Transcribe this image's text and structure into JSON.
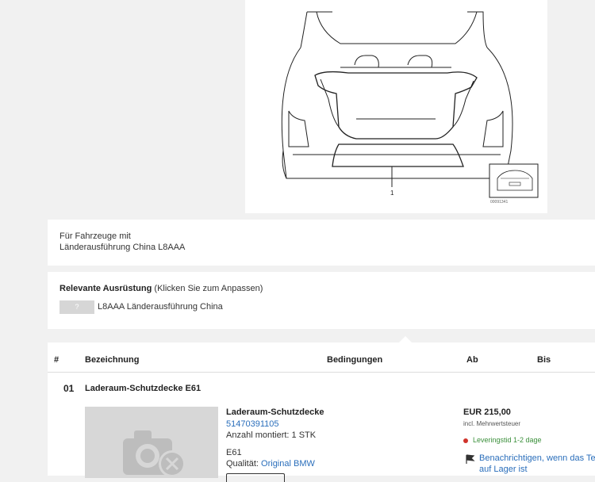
{
  "diagram": {
    "callout": "1",
    "thumb_code": "00091341"
  },
  "vehicle_note": {
    "line1": "Für Fahrzeuge mit",
    "line2": "Länderausführung China L8AAA"
  },
  "equipment": {
    "heading": "Relevante Ausrüstung",
    "hint": "(Klicken Sie zum Anpassen)",
    "chip": "?",
    "item": "L8AAA Länderausführung China"
  },
  "table": {
    "headers": {
      "num": "#",
      "name": "Bezeichnung",
      "conditions": "Bedingungen",
      "from": "Ab",
      "to": "Bis"
    },
    "row": {
      "num": "01",
      "title": "Laderaum-Schutzdecke E61",
      "detail_title": "Laderaum-Schutzdecke",
      "part_number": "51470391105",
      "quantity": "Anzahl montiert: 1 STK",
      "model": "E61",
      "quality_label": "Qualität: ",
      "quality_value": "Original BMW",
      "price": "EUR 215,00",
      "vat": "incl. Mehrwertsteuer",
      "delivery": "Leveringstid 1-2 dage",
      "notify_line1": "Benachrichtigen, wenn das Teil",
      "notify_line2": "auf Lager ist"
    }
  },
  "colors": {
    "link": "#2a6ebb",
    "delivery": "#3a8f3a",
    "status_dot": "#d0332b"
  }
}
